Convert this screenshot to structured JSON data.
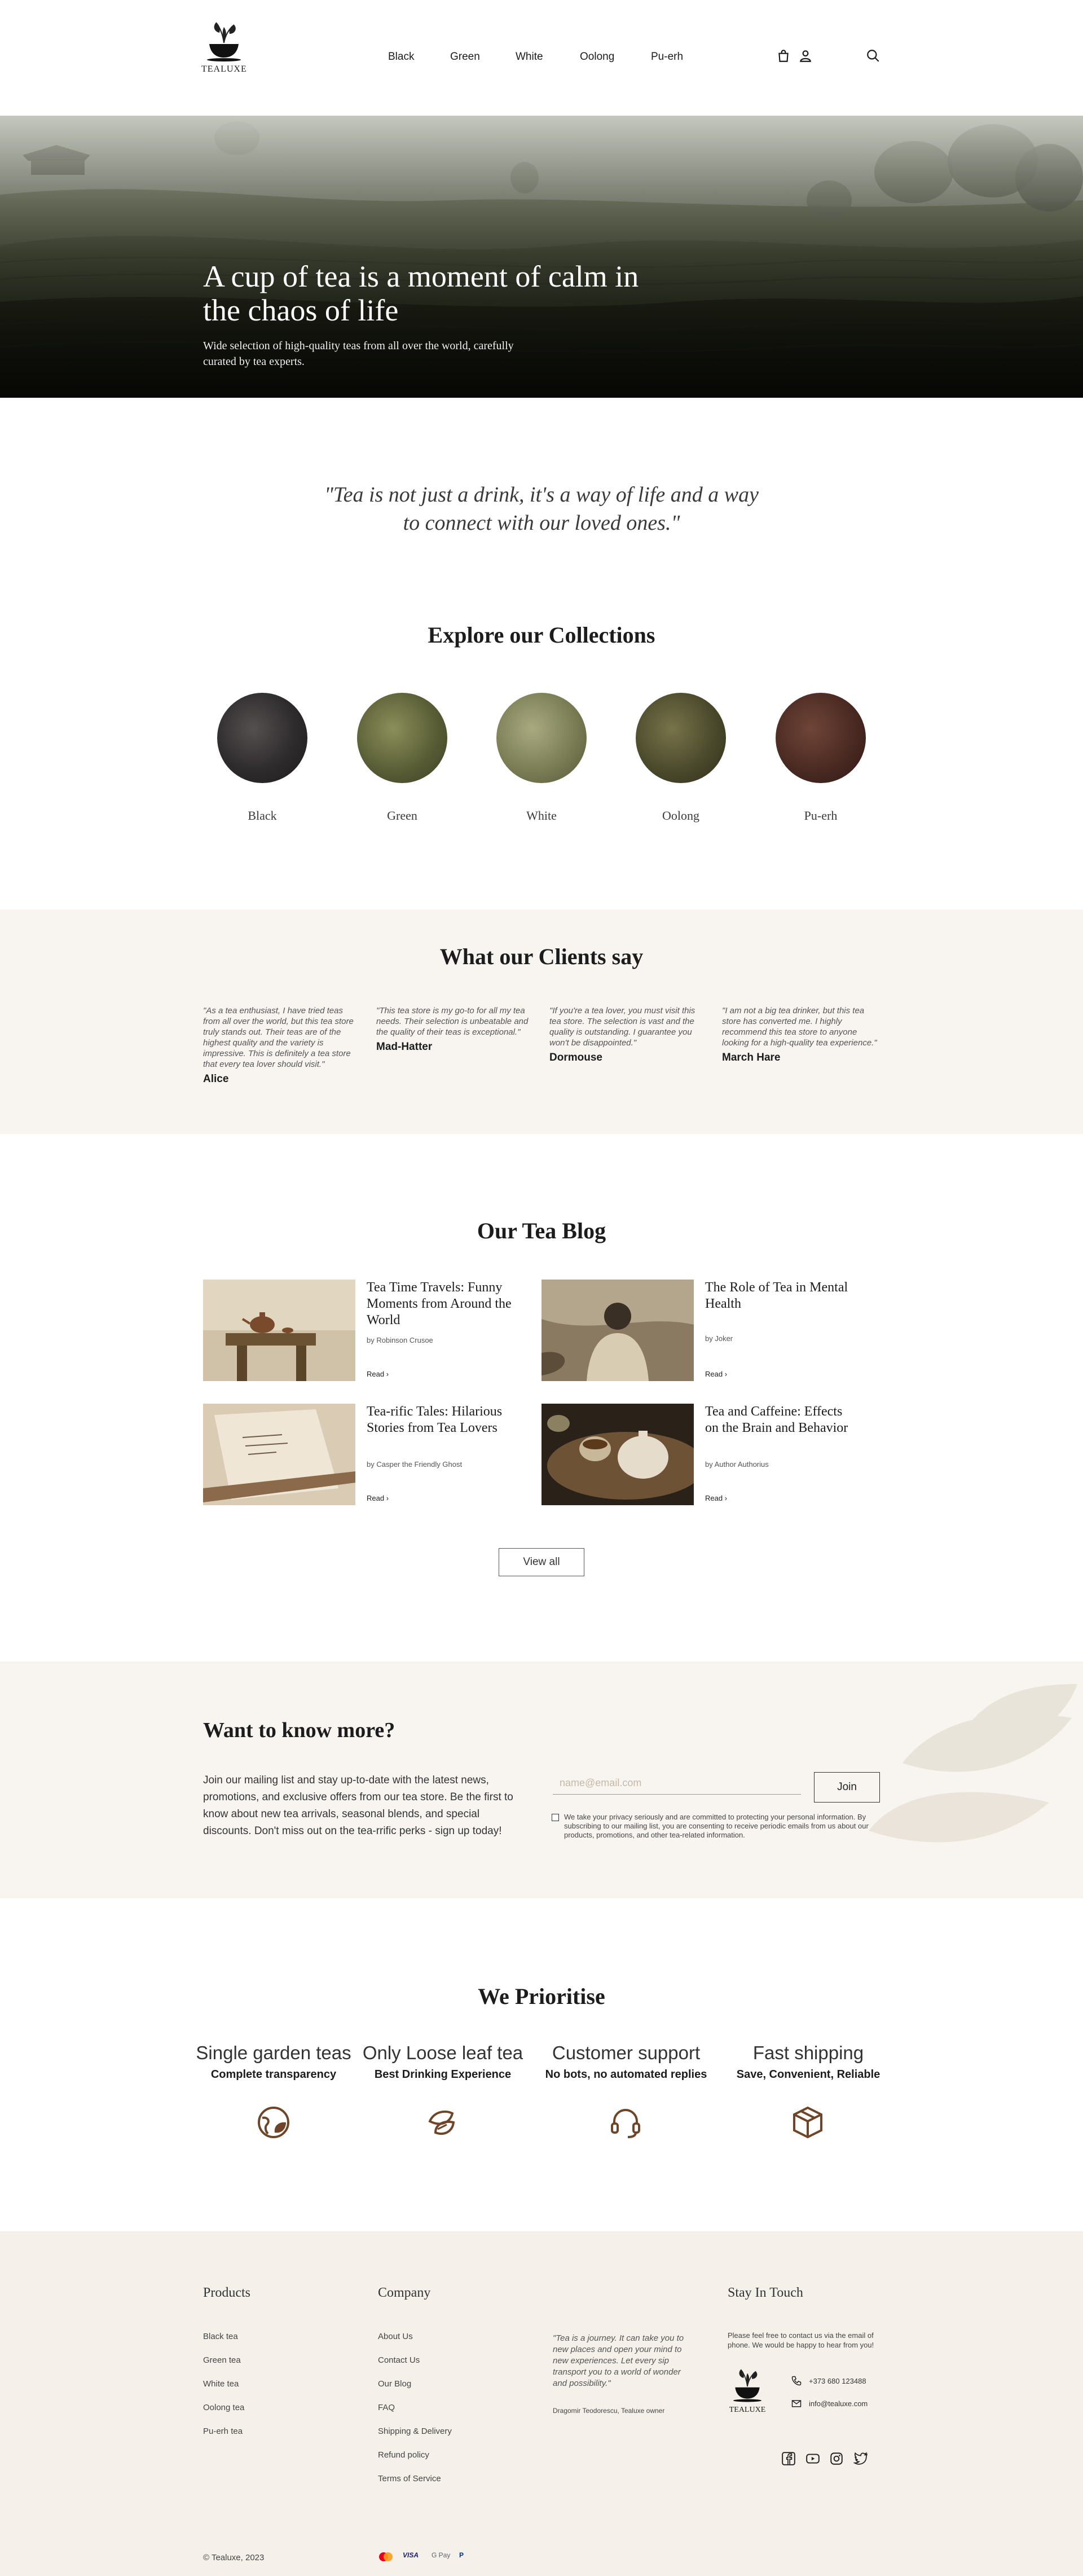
{
  "brand": {
    "logo_text": "TEALUXE"
  },
  "nav": {
    "items": [
      "Black",
      "Green",
      "White",
      "Oolong",
      "Pu-erh"
    ]
  },
  "icons": {
    "cart": "bag-icon",
    "account": "user-icon",
    "search": "search-icon"
  },
  "hero": {
    "title": "A cup of tea is a moment of calm in the chaos of life",
    "subtitle": "Wide selection of high-quality teas from all over the world, carefully curated by tea experts."
  },
  "quote": "\"Tea is not just a drink, it's a way of life and a way to connect with our loved ones.\"",
  "collections": {
    "title": "Explore our Collections",
    "items": [
      {
        "label": "Black",
        "color": "#2e2b2d"
      },
      {
        "label": "Green",
        "color": "#5a5e36"
      },
      {
        "label": "White",
        "color": "#7b7d55"
      },
      {
        "label": "Oolong",
        "color": "#4b4a2c"
      },
      {
        "label": "Pu-erh",
        "color": "#4a2a22"
      }
    ]
  },
  "testimonials": {
    "title": "What our Clients say",
    "items": [
      {
        "text": "\"As a tea enthusiast, I have tried teas from all over the world, but this tea store truly stands out. Their teas are of the highest quality and the variety is impressive. This is definitely a tea store that every tea lover should visit.\"",
        "name": "Alice"
      },
      {
        "text": "\"This tea store is my go-to for all my tea needs. Their selection is unbeatable and the quality of their teas is exceptional.\"",
        "name": "Mad-Hatter"
      },
      {
        "text": "\"If you're a tea lover, you must visit this tea store. The selection is vast and the quality is outstanding. I guarantee you won't be disappointed.\"",
        "name": "Dormouse"
      },
      {
        "text": "\"I am not a big tea drinker, but this tea store has converted me. I highly recommend this tea store to anyone looking for a high-quality tea experience.\"",
        "name": "March Hare"
      }
    ]
  },
  "blog": {
    "title": "Our Tea Blog",
    "read_label": "Read",
    "posts": [
      {
        "title": "Tea Time Travels: Funny Moments from Around the World",
        "author": "by Robinson Crusoe"
      },
      {
        "title": "The Role of Tea in Mental Health",
        "author": "by Joker"
      },
      {
        "title": "Tea-rific Tales: Hilarious Stories from Tea Lovers",
        "author": "by Casper the Friendly Ghost"
      },
      {
        "title": "Tea and Caffeine: Effects on the Brain and Behavior",
        "author": "by Author Authorius"
      }
    ],
    "view_all": "View all"
  },
  "newsletter": {
    "title": "Want to know more?",
    "body": "Join our mailing list and stay up-to-date with the latest news, promotions, and exclusive offers from our tea store. Be the first to know about new tea arrivals, seasonal blends, and special discounts. Don't miss out on the tea-rrific perks - sign up today!",
    "placeholder": "name@email.com",
    "button": "Join",
    "consent": "We take your privacy seriously and are committed to protecting your personal information. By subscribing to our mailing list, you are consenting to receive periodic emails from us about our products, promotions, and other tea-related information."
  },
  "prioritise": {
    "title": "We Prioritise",
    "items": [
      {
        "title": "Single garden teas",
        "subtitle": "Complete transparency",
        "icon": "globe-leaf-icon"
      },
      {
        "title": "Only Loose leaf tea",
        "subtitle": "Best Drinking Experience",
        "icon": "tea-leaves-icon"
      },
      {
        "title": "Customer support",
        "subtitle": "No bots, no automated replies",
        "icon": "headset-icon"
      },
      {
        "title": "Fast shipping",
        "subtitle": "Save, Convenient, Reliable",
        "icon": "box-icon"
      }
    ]
  },
  "footer": {
    "products": {
      "title": "Products",
      "links": [
        "Black tea",
        "Green tea",
        "White tea",
        "Oolong tea",
        "Pu-erh tea"
      ]
    },
    "company": {
      "title": "Company",
      "links": [
        "About Us",
        "Contact Us",
        "Our Blog",
        "FAQ",
        "Shipping & Delivery",
        "Refund policy",
        "Terms of Service"
      ]
    },
    "quote": "\"Tea is a journey. It can take you to new places and open your mind to new experiences. Let every sip transport you to a world of wonder and possibility.\"",
    "quote_author": "Dragomir Teodorescu, Tealuxe owner",
    "contact": {
      "title": "Stay In Touch",
      "text": "Please feel free to contact us via the email of phone. We would be happy to hear from you!",
      "phone": "+373 680 123488",
      "email": "info@tealuxe.com"
    },
    "social": [
      "facebook-icon",
      "youtube-icon",
      "instagram-icon",
      "twitter-icon"
    ],
    "copyright": "© Tealuxe, 2023",
    "payments": [
      "mastercard-icon",
      "VISA",
      "G Pay",
      "P"
    ]
  },
  "colors": {
    "accent_brown": "#6e4528",
    "beige": "#f8f5f0",
    "footer_bg": "#f5f0e9"
  }
}
